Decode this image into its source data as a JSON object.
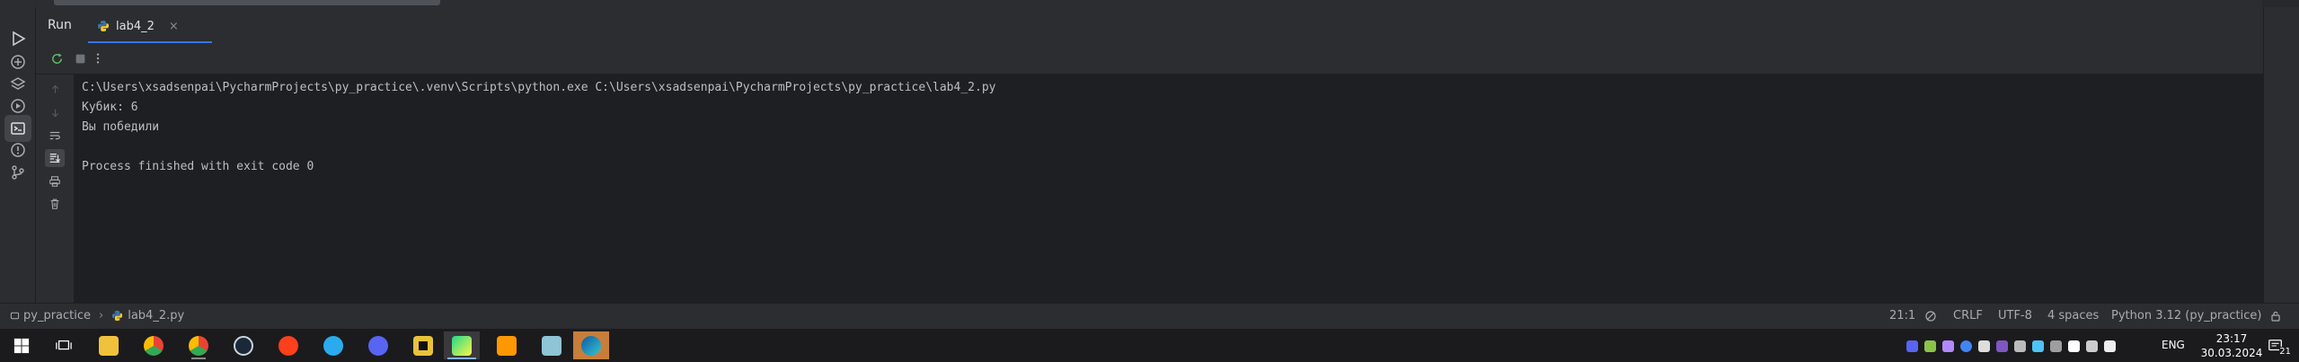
{
  "run_panel": {
    "title": "Run",
    "tab": {
      "label": "lab4_2",
      "close": "×"
    }
  },
  "console": {
    "lines": [
      "C:\\Users\\xsadsenpai\\PycharmProjects\\py_practice\\.venv\\Scripts\\python.exe C:\\Users\\xsadsenpai\\PycharmProjects\\py_practice\\lab4_2.py",
      "Кубик: 6",
      "Вы победили",
      "",
      "Process finished with exit code 0"
    ]
  },
  "breadcrumb": {
    "project": "py_practice",
    "separator": "›",
    "file": "lab4_2.py"
  },
  "status": {
    "position": "21:1",
    "line_ending": "CRLF",
    "encoding": "UTF-8",
    "indent": "4 spaces",
    "interpreter": "Python 3.12 (py_practice)"
  },
  "taskbar": {
    "lang": "ENG",
    "time": "23:17",
    "date": "30.03.2024",
    "notifications": "21"
  },
  "colors": {
    "accent": "#3574f0",
    "python_blue": "#3b77a8",
    "python_yellow": "#f5c933",
    "pycharm_green": "#21d789"
  }
}
